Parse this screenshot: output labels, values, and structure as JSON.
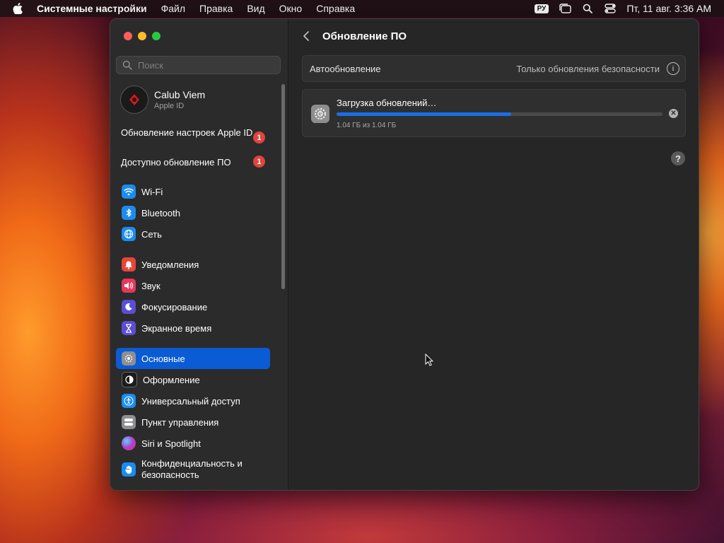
{
  "menubar": {
    "app_name": "Системные настройки",
    "menus": [
      "Файл",
      "Правка",
      "Вид",
      "Окно",
      "Справка"
    ],
    "input_language": "РУ",
    "datetime": "Пт, 11 авг.  3:36 AM"
  },
  "sidebar": {
    "search_placeholder": "Поиск",
    "profile": {
      "name": "Calub Viem",
      "subtitle": "Apple ID"
    },
    "notices": [
      {
        "label": "Обновление настроек Apple ID",
        "badge": "1"
      },
      {
        "label": "Доступно обновление ПО",
        "badge": "1"
      }
    ],
    "items": [
      {
        "label": "Wi-Fi",
        "icon": "wifi-icon",
        "color": "#1a8cf0"
      },
      {
        "label": "Bluetooth",
        "icon": "bluetooth-icon",
        "color": "#1a8cf0"
      },
      {
        "label": "Сеть",
        "icon": "globe-icon",
        "color": "#1a8cf0"
      },
      {
        "label": "Уведомления",
        "icon": "bell-icon",
        "color": "#e8453c"
      },
      {
        "label": "Звук",
        "icon": "speaker-icon",
        "color": "#e8375a"
      },
      {
        "label": "Фокусирование",
        "icon": "moon-icon",
        "color": "#5b4ed6"
      },
      {
        "label": "Экранное время",
        "icon": "hourglass-icon",
        "color": "#5b4ed6"
      },
      {
        "label": "Основные",
        "icon": "gear-icon",
        "color": "#8e8e93",
        "selected": true
      },
      {
        "label": "Оформление",
        "icon": "appearance-icon",
        "color": "#1c1c1c"
      },
      {
        "label": "Универсальный доступ",
        "icon": "accessibility-icon",
        "color": "#1a8cf0"
      },
      {
        "label": "Пункт управления",
        "icon": "control-center-icon",
        "color": "#8e8e93"
      },
      {
        "label": "Siri и Spotlight",
        "icon": "siri-icon",
        "color": "#b03fd0"
      },
      {
        "label": "Конфиденциальность и безопасность",
        "icon": "hand-icon",
        "color": "#1a8cf0"
      }
    ]
  },
  "main": {
    "title": "Обновление ПО",
    "auto_update": {
      "label": "Автообновление",
      "value": "Только обновления безопасности"
    },
    "download": {
      "title": "Загрузка обновлений…",
      "progress": 0.535,
      "size_text": "1.04 ГБ из 1.04 ГБ"
    },
    "help": "?"
  }
}
